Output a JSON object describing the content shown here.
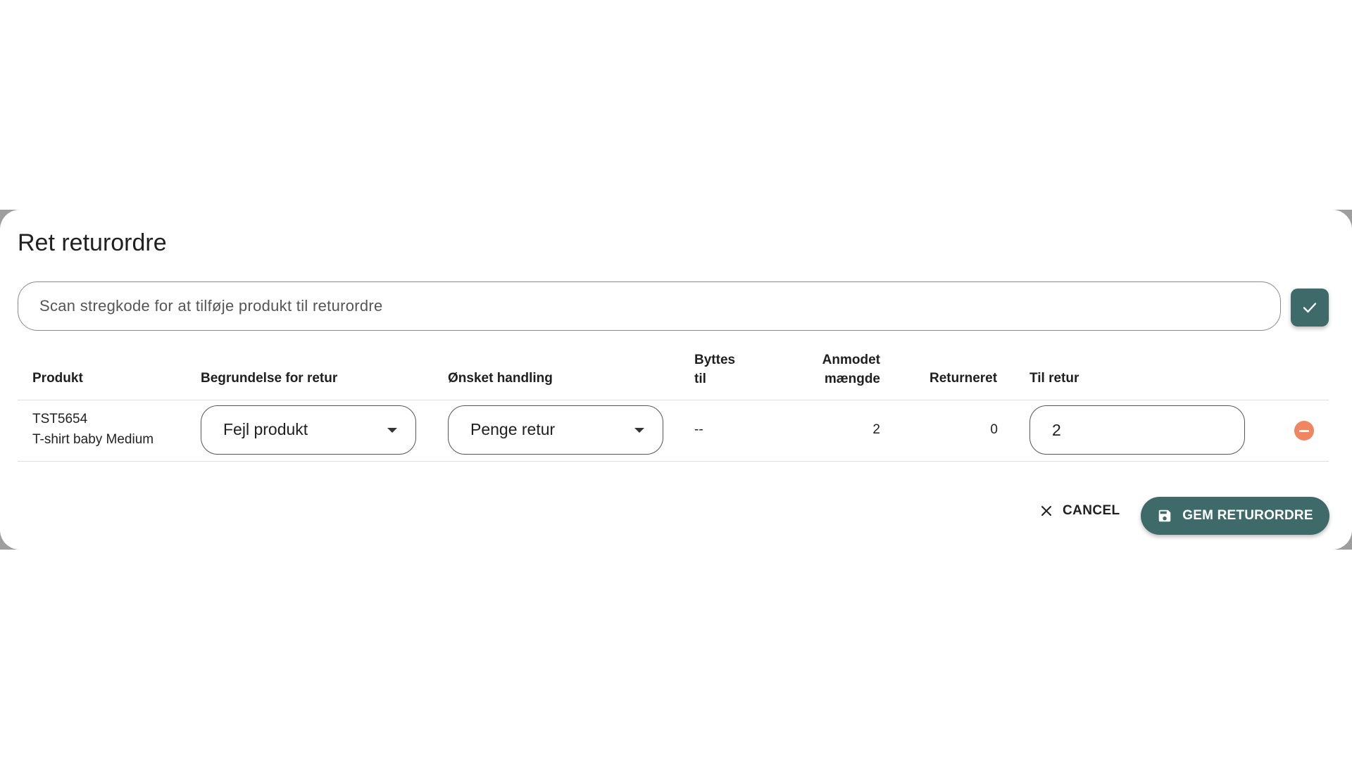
{
  "dialog": {
    "title": "Ret returordre"
  },
  "scan": {
    "placeholder": "Scan stregkode for at tilføje produkt til returordre",
    "value": ""
  },
  "table": {
    "headers": {
      "product": "Produkt",
      "reason": "Begrundelse for retur",
      "action": "Ønsket handling",
      "exchange_line1": "Byttes",
      "exchange_line2": "til",
      "requested_line1": "Anmodet",
      "requested_line2": "mængde",
      "returned": "Returneret",
      "to_return": "Til retur"
    },
    "rows": [
      {
        "product_code": "TST5654",
        "product_name": "T-shirt baby Medium",
        "reason": "Fejl produkt",
        "action": "Penge retur",
        "exchange": "--",
        "requested": "2",
        "returned": "0",
        "to_return": "2"
      }
    ]
  },
  "footer": {
    "cancel_label": "CANCEL",
    "save_label": "GEM RETURORDRE"
  },
  "colors": {
    "primary": "#3f6a6a",
    "remove": "#f18561",
    "border": "#8a8a8a"
  },
  "icons": {
    "confirm": "check-icon",
    "remove": "minus-circle-icon",
    "cancel": "close-icon",
    "save": "save-icon",
    "select": "caret-down-icon"
  }
}
